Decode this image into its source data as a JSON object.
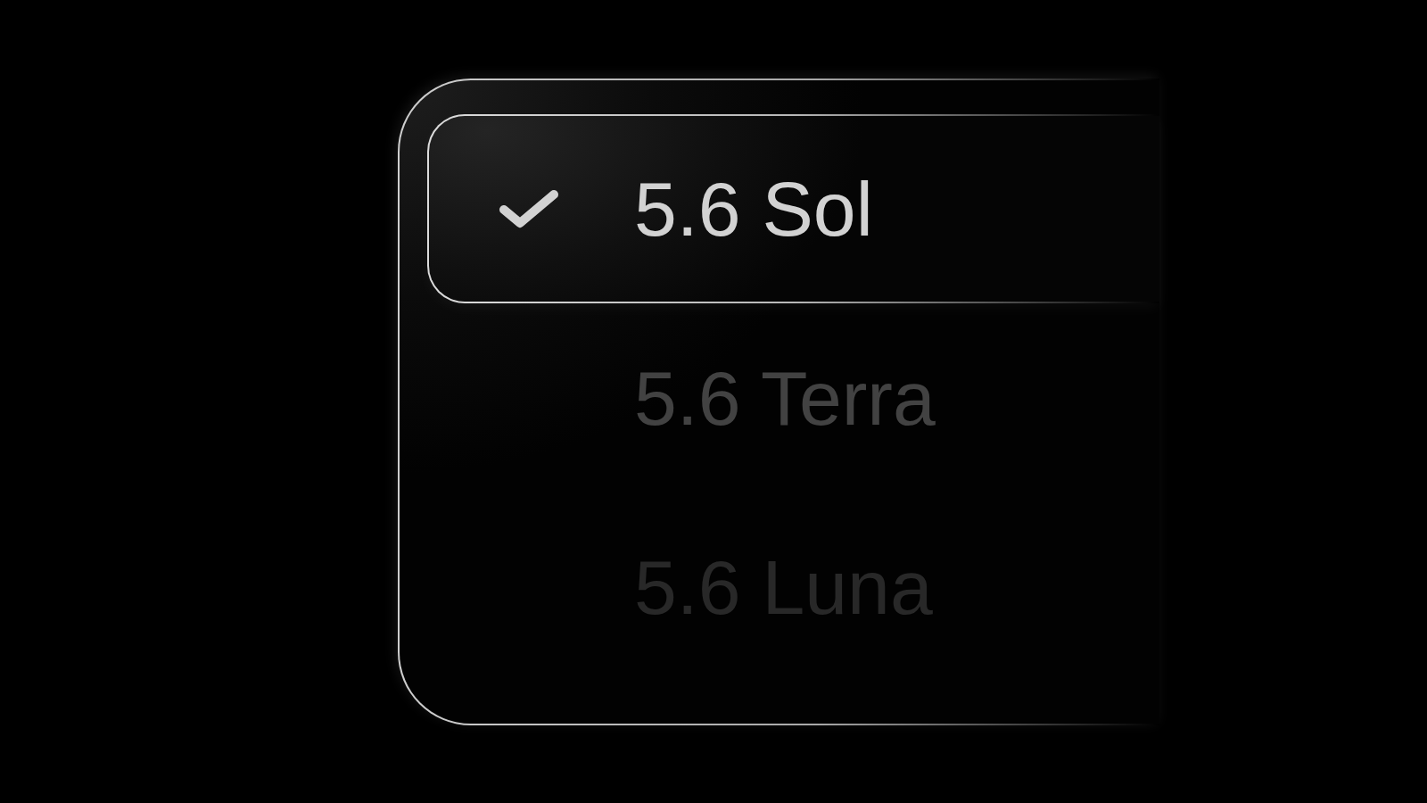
{
  "menu": {
    "items": [
      {
        "label": "5.6 Sol",
        "selected": true
      },
      {
        "label": "5.6 Terra",
        "selected": false
      },
      {
        "label": "5.6 Luna",
        "selected": false
      }
    ]
  }
}
